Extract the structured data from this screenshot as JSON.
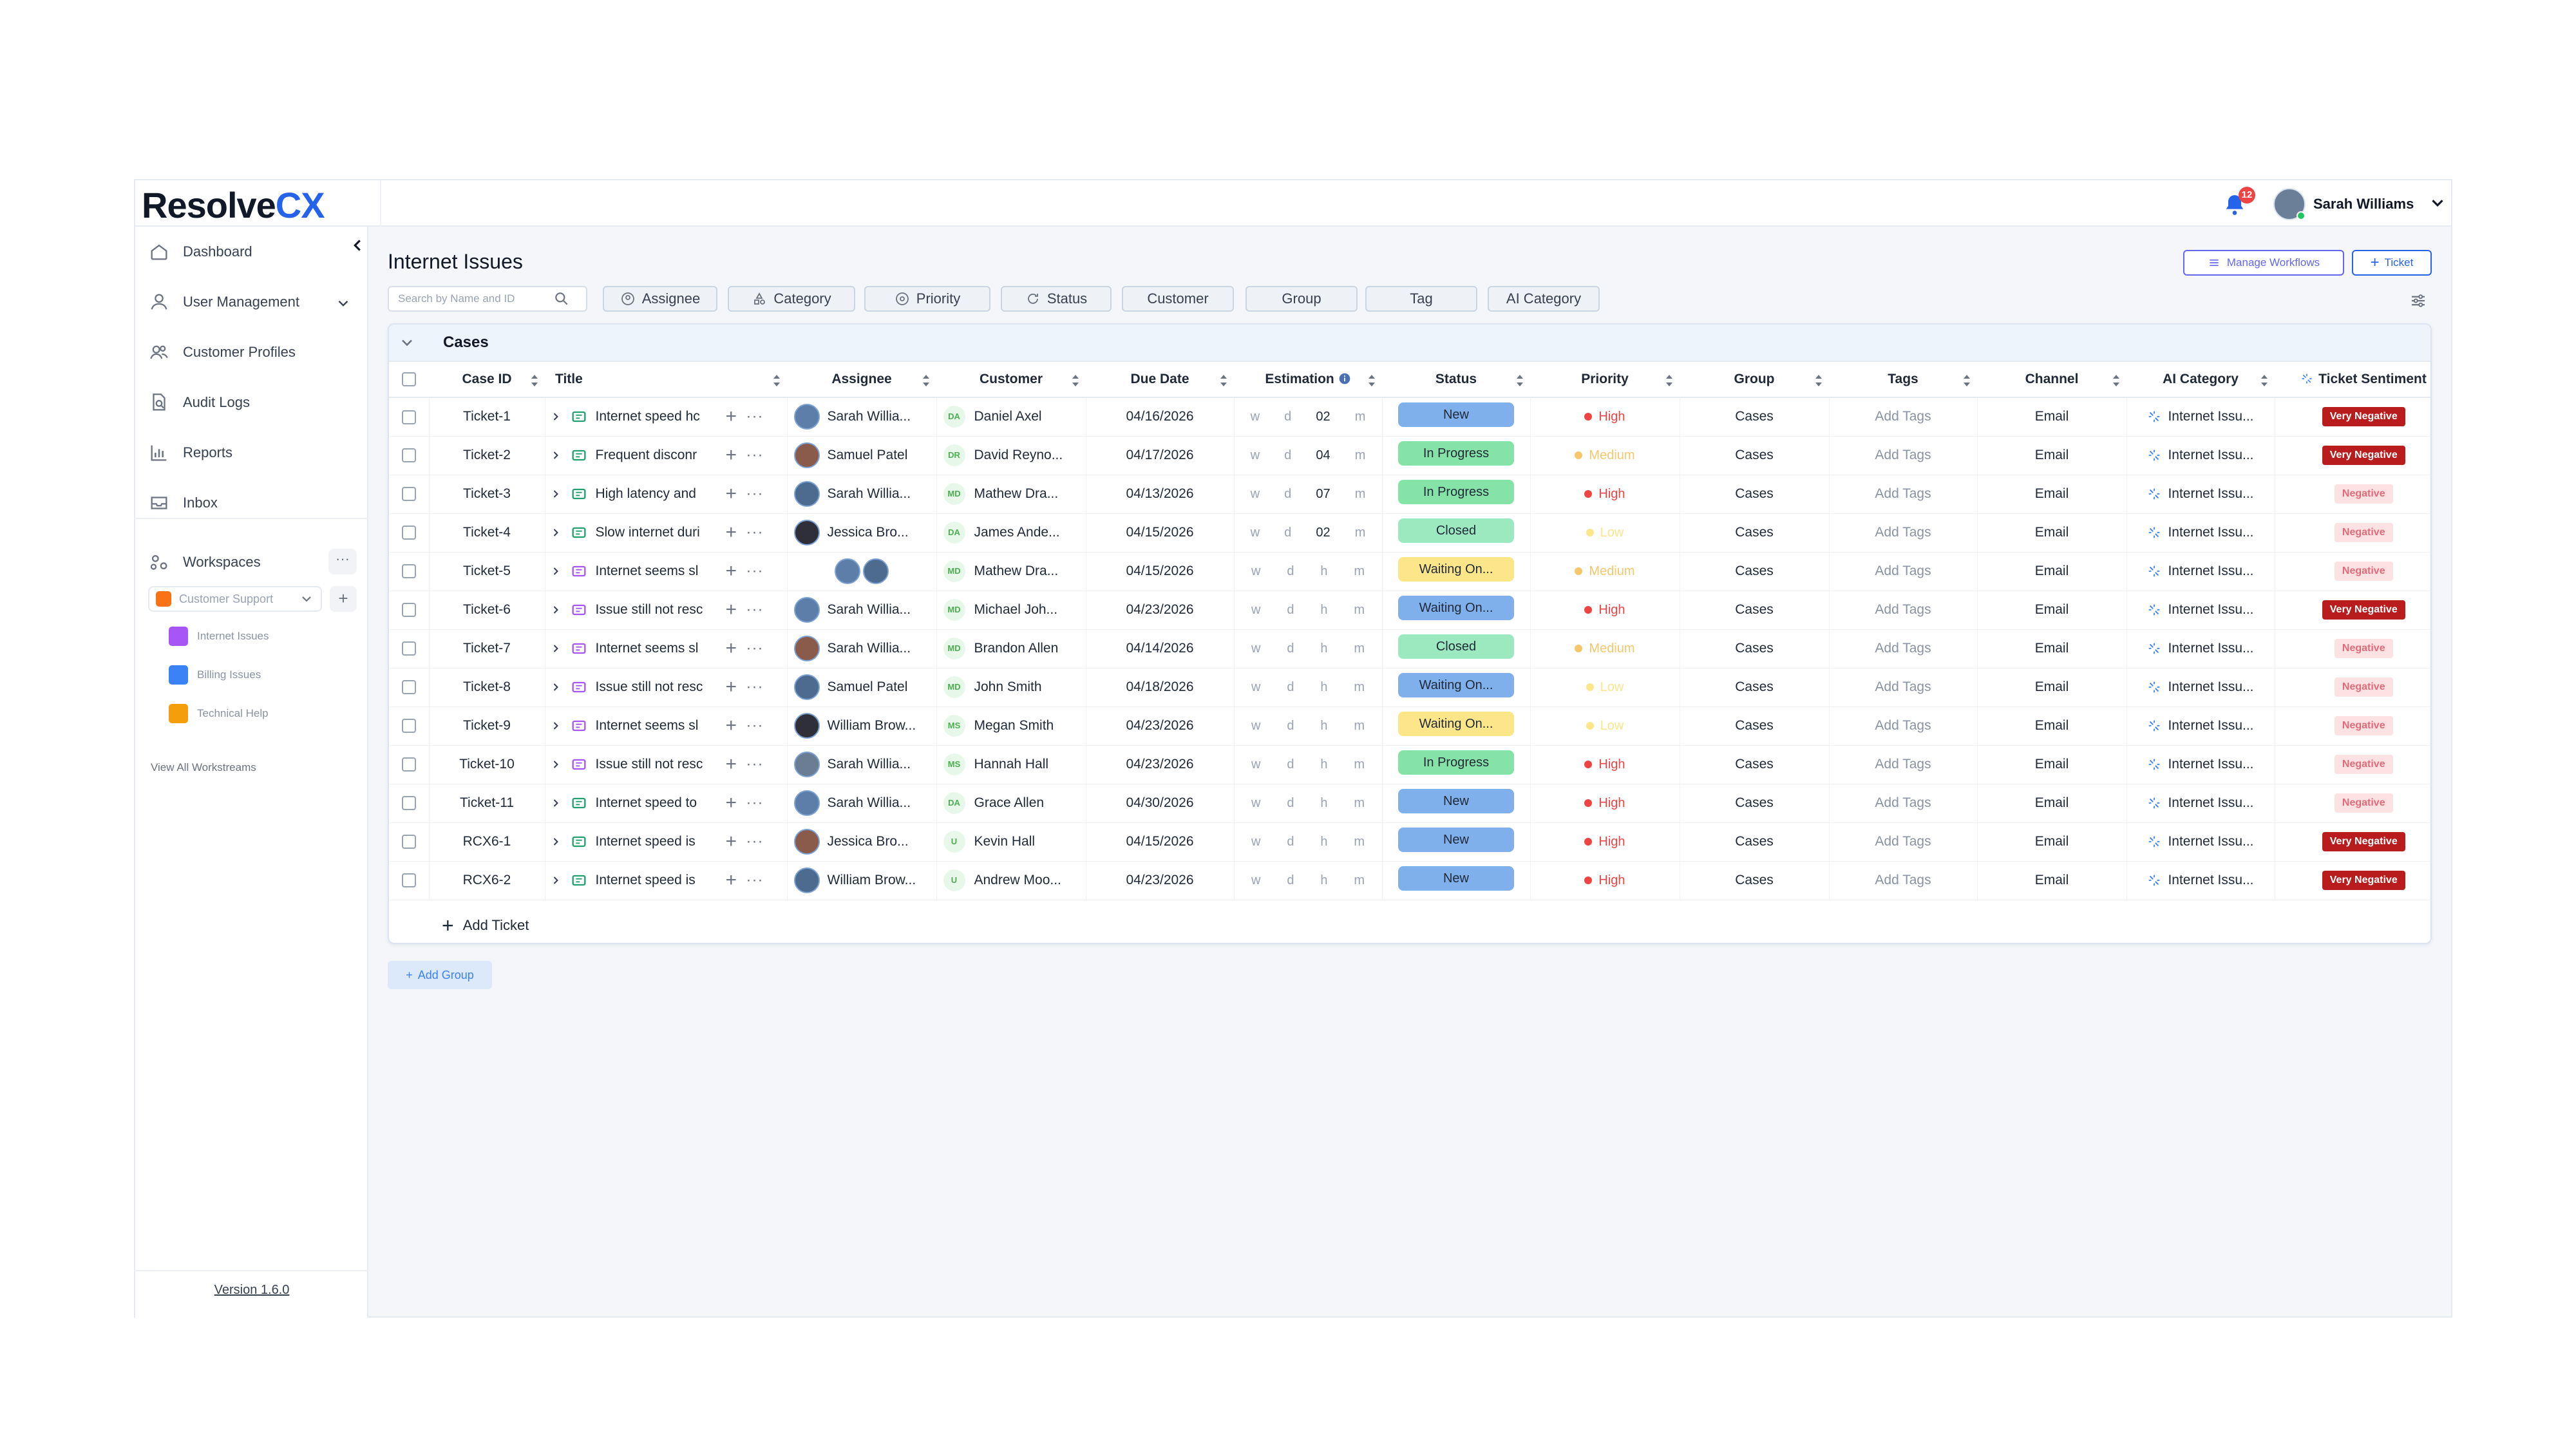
{
  "app": {
    "logo_main": "Resolve",
    "logo_accent": "CX",
    "accent_color": "#2563eb",
    "notifications_count": "12",
    "user_name": "Sarah Williams"
  },
  "sidebar": {
    "items": [
      {
        "label": "Dashboard",
        "icon": "home-icon"
      },
      {
        "label": "User Management",
        "icon": "user-icon"
      },
      {
        "label": "Customer Profiles",
        "icon": "users-icon"
      },
      {
        "label": "Audit Logs",
        "icon": "document-search-icon"
      },
      {
        "label": "Reports",
        "icon": "bar-chart-icon"
      },
      {
        "label": "Inbox",
        "icon": "inbox-icon"
      }
    ],
    "workspaces_label": "Workspaces",
    "workspace_selected": "Customer Support",
    "workstreams": [
      {
        "label": "Internet Issues",
        "color": "#a855f7"
      },
      {
        "label": "Billing Issues",
        "color": "#3b82f6"
      },
      {
        "label": "Technical Help",
        "color": "#f59e0b"
      }
    ],
    "view_all": "View All Workstreams",
    "version": "Version 1.6.0"
  },
  "main": {
    "title": "Internet Issues",
    "manage_workflows": "Manage Workflows",
    "ticket_button": "Ticket",
    "search_placeholder": "Search by Name and ID",
    "filters": [
      "Assignee",
      "Category",
      "Priority",
      "Status",
      "Customer",
      "Group",
      "Tag",
      "AI Category"
    ],
    "group_title": "Cases",
    "add_ticket": "Add Ticket",
    "add_group": "Add Group"
  },
  "table": {
    "columns": [
      "Case ID",
      "Title",
      "Assignee",
      "Customer",
      "Due Date",
      "Estimation",
      "Status",
      "Priority",
      "Group",
      "Tags",
      "Channel",
      "AI Category",
      "Ticket Sentiment"
    ],
    "est_labels": [
      "w",
      "d",
      "h",
      "m"
    ],
    "rows": [
      {
        "id": "Ticket-1",
        "title": "Internet speed hc",
        "assignee": "Sarah Willia...",
        "cust_initials": "DA",
        "customer": "Daniel Axel",
        "due": "04/16/2026",
        "est_h": "02",
        "status": "New",
        "priority": "High",
        "group": "Cases",
        "tags": "Add Tags",
        "channel": "Email",
        "ai": "Internet Issu...",
        "sentiment": "Very Negative"
      },
      {
        "id": "Ticket-2",
        "title": "Frequent disconr",
        "assignee": "Samuel Patel",
        "cust_initials": "DR",
        "customer": "David Reyno...",
        "due": "04/17/2026",
        "est_h": "04",
        "status": "In Progress",
        "priority": "Medium",
        "group": "Cases",
        "tags": "Add Tags",
        "channel": "Email",
        "ai": "Internet Issu...",
        "sentiment": "Very Negative"
      },
      {
        "id": "Ticket-3",
        "title": "High latency and",
        "assignee": "Sarah Willia...",
        "cust_initials": "MD",
        "customer": "Mathew Dra...",
        "due": "04/13/2026",
        "est_h": "07",
        "status": "In Progress",
        "priority": "High",
        "group": "Cases",
        "tags": "Add Tags",
        "channel": "Email",
        "ai": "Internet Issu...",
        "sentiment": "Negative"
      },
      {
        "id": "Ticket-4",
        "title": "Slow internet duri",
        "assignee": "Jessica Bro...",
        "cust_initials": "DA",
        "customer": "James Ande...",
        "due": "04/15/2026",
        "est_h": "02",
        "status": "Closed",
        "priority": "Low",
        "group": "Cases",
        "tags": "Add Tags",
        "channel": "Email",
        "ai": "Internet Issu...",
        "sentiment": "Negative"
      },
      {
        "id": "Ticket-5",
        "title": "Internet seems sl",
        "assignee": "",
        "cust_initials": "MD",
        "customer": "Mathew Dra...",
        "due": "04/15/2026",
        "est_h": "",
        "status": "Waiting On...",
        "priority": "Medium",
        "group": "Cases",
        "tags": "Add Tags",
        "channel": "Email",
        "ai": "Internet Issu...",
        "sentiment": "Negative"
      },
      {
        "id": "Ticket-6",
        "title": "Issue still not resc",
        "assignee": "Sarah Willia...",
        "cust_initials": "MD",
        "customer": "Michael Joh...",
        "due": "04/23/2026",
        "est_h": "",
        "status": "Waiting On...",
        "priority": "High",
        "group": "Cases",
        "tags": "Add Tags",
        "channel": "Email",
        "ai": "Internet Issu...",
        "sentiment": "Very Negative"
      },
      {
        "id": "Ticket-7",
        "title": "Internet seems sl",
        "assignee": "Sarah Willia...",
        "cust_initials": "MD",
        "customer": "Brandon Allen",
        "due": "04/14/2026",
        "est_h": "",
        "status": "Closed",
        "priority": "Medium",
        "group": "Cases",
        "tags": "Add Tags",
        "channel": "Email",
        "ai": "Internet Issu...",
        "sentiment": "Negative"
      },
      {
        "id": "Ticket-8",
        "title": "Issue still not resc",
        "assignee": "Samuel Patel",
        "cust_initials": "MD",
        "customer": "John Smith",
        "due": "04/18/2026",
        "est_h": "",
        "status": "Waiting On...",
        "priority": "Low",
        "group": "Cases",
        "tags": "Add Tags",
        "channel": "Email",
        "ai": "Internet Issu...",
        "sentiment": "Negative"
      },
      {
        "id": "Ticket-9",
        "title": "Internet seems sl",
        "assignee": "William Brow...",
        "cust_initials": "MS",
        "customer": "Megan Smith",
        "due": "04/23/2026",
        "est_h": "",
        "status": "Waiting On...",
        "priority": "Low",
        "group": "Cases",
        "tags": "Add Tags",
        "channel": "Email",
        "ai": "Internet Issu...",
        "sentiment": "Negative"
      },
      {
        "id": "Ticket-10",
        "title": "Issue still not resc",
        "assignee": "Sarah Willia...",
        "cust_initials": "MS",
        "customer": "Hannah Hall",
        "due": "04/23/2026",
        "est_h": "",
        "status": "In Progress",
        "priority": "High",
        "group": "Cases",
        "tags": "Add Tags",
        "channel": "Email",
        "ai": "Internet Issu...",
        "sentiment": "Negative"
      },
      {
        "id": "Ticket-11",
        "title": "Internet speed to",
        "assignee": "Sarah Willia...",
        "cust_initials": "DA",
        "customer": "Grace Allen",
        "due": "04/30/2026",
        "est_h": "",
        "status": "New",
        "priority": "High",
        "group": "Cases",
        "tags": "Add Tags",
        "channel": "Email",
        "ai": "Internet Issu...",
        "sentiment": "Negative"
      },
      {
        "id": "RCX6-1",
        "title": "Internet speed is",
        "assignee": "Jessica Bro...",
        "cust_initials": "U",
        "customer": "Kevin Hall",
        "due": "04/15/2026",
        "est_h": "",
        "status": "New",
        "priority": "High",
        "group": "Cases",
        "tags": "Add Tags",
        "channel": "Email",
        "ai": "Internet Issu...",
        "sentiment": "Very Negative"
      },
      {
        "id": "RCX6-2",
        "title": "Internet speed is",
        "assignee": "William Brow...",
        "cust_initials": "U",
        "customer": "Andrew Moo...",
        "due": "04/23/2026",
        "est_h": "",
        "status": "New",
        "priority": "High",
        "group": "Cases",
        "tags": "Add Tags",
        "channel": "Email",
        "ai": "Internet Issu...",
        "sentiment": "Very Negative"
      }
    ]
  },
  "colors": {
    "status": {
      "New": "#7fb0ec",
      "In Progress": "#86e3a8",
      "Closed": "#9ce9bf",
      "Waiting On...": "#fde68a"
    },
    "status_waiting_blue": "#7fb0ec",
    "priority": {
      "High": "#ef4444",
      "Medium": "#f6c76b",
      "Low": "#fde68a"
    },
    "sentiment": {
      "Very Negative": "#b91c1c",
      "Negative": "#fde2e4"
    }
  }
}
